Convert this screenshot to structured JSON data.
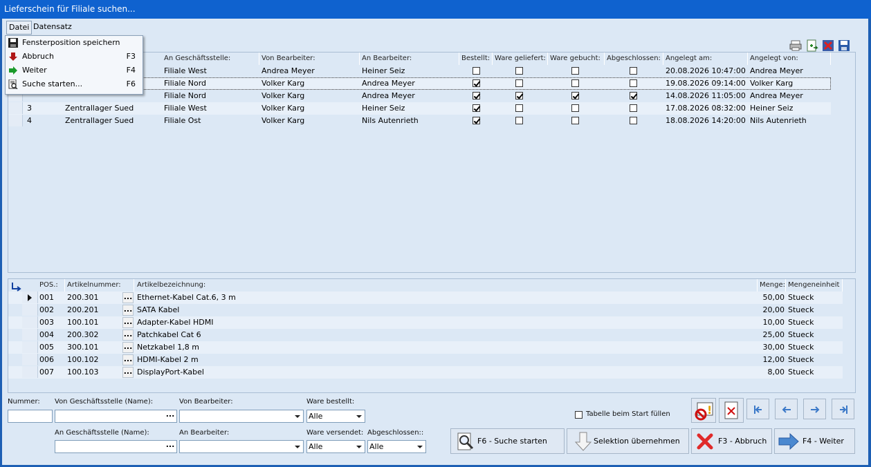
{
  "window": {
    "title": "Lieferschein für Filiale suchen..."
  },
  "menu": {
    "items": [
      {
        "label": "Datei"
      },
      {
        "label": "Datensatz"
      }
    ],
    "dropdown": [
      {
        "label": "Fensterposition speichern",
        "key": "",
        "icon": "floppy-icon"
      },
      {
        "label": "Abbruch",
        "key": "F3",
        "icon": "arrow-down-red-icon"
      },
      {
        "label": "Weiter",
        "key": "F4",
        "icon": "arrow-right-green-icon"
      },
      {
        "label": "Suche starten...",
        "key": "F6",
        "icon": "search-document-icon"
      }
    ]
  },
  "top_grid": {
    "columns": [
      "",
      "",
      "An Geschäftsstelle:",
      "Von Bearbeiter:",
      "An Bearbeiter:",
      "Bestellt:",
      "Ware geliefert:",
      "Ware gebucht:",
      "Abgeschlossen:",
      "Angelegt am:",
      "Angelegt von:"
    ],
    "rows": [
      {
        "nr": "",
        "von": "",
        "an": "Filiale West",
        "von_bearb": "Andrea Meyer",
        "an_bearb": "Heiner Seiz",
        "bestellt": false,
        "geliefert": false,
        "gebucht": false,
        "abgeschlossen": false,
        "am": "20.08.2026 10:47:00",
        "von_user": "Andrea Meyer"
      },
      {
        "nr": "",
        "von": "",
        "an": "Filiale Nord",
        "von_bearb": "Volker Karg",
        "an_bearb": "Andrea Meyer",
        "bestellt": true,
        "geliefert": false,
        "gebucht": false,
        "abgeschlossen": false,
        "am": "19.08.2026 09:14:00",
        "von_user": "Volker Karg"
      },
      {
        "nr": "",
        "von": "",
        "an": "Filiale Nord",
        "von_bearb": "Volker Karg",
        "an_bearb": "Andrea Meyer",
        "bestellt": true,
        "geliefert": true,
        "gebucht": true,
        "abgeschlossen": true,
        "am": "14.08.2026 11:05:00",
        "von_user": "Andrea Meyer"
      },
      {
        "nr": "3",
        "von": "Zentrallager Sued",
        "an": "Filiale West",
        "von_bearb": "Volker Karg",
        "an_bearb": "Heiner Seiz",
        "bestellt": true,
        "geliefert": false,
        "gebucht": false,
        "abgeschlossen": false,
        "am": "17.08.2026 08:32:00",
        "von_user": "Heiner Seiz"
      },
      {
        "nr": "4",
        "von": "Zentrallager Sued",
        "an": "Filiale Ost",
        "von_bearb": "Volker Karg",
        "an_bearb": "Nils Autenrieth",
        "bestellt": true,
        "geliefert": false,
        "gebucht": false,
        "abgeschlossen": false,
        "am": "18.08.2026 14:20:00",
        "von_user": "Nils Autenrieth"
      }
    ]
  },
  "bottom_grid": {
    "columns": [
      "POS.:",
      "Artikelnummer:",
      "Artikelbezeichnung:",
      "Menge:",
      "Mengeneinheit"
    ],
    "rows": [
      {
        "pos": "001",
        "artnr": "200.301",
        "dots": "...",
        "bez": "Ethernet-Kabel Cat.6, 3 m",
        "menge": "50,00",
        "einheit": "Stueck"
      },
      {
        "pos": "002",
        "artnr": "200.201",
        "dots": "...",
        "bez": "SATA Kabel",
        "menge": "20,00",
        "einheit": "Stueck"
      },
      {
        "pos": "003",
        "artnr": "100.101",
        "dots": "...",
        "bez": "Adapter-Kabel HDMI",
        "menge": "10,00",
        "einheit": "Stueck"
      },
      {
        "pos": "004",
        "artnr": "200.302",
        "dots": "...",
        "bez": "Patchkabel Cat 6",
        "menge": "25,00",
        "einheit": "Stueck"
      },
      {
        "pos": "005",
        "artnr": "300.101",
        "dots": "...",
        "bez": "Netzkabel 1,8 m",
        "menge": "30,00",
        "einheit": "Stueck"
      },
      {
        "pos": "006",
        "artnr": "100.102",
        "dots": "...",
        "bez": "HDMI-Kabel 2 m",
        "menge": "12,00",
        "einheit": "Stueck"
      },
      {
        "pos": "007",
        "artnr": "100.103",
        "dots": "...",
        "bez": "DisplayPort-Kabel",
        "menge": "8,00",
        "einheit": "Stueck"
      }
    ]
  },
  "filters": {
    "nummer_label": "Nummer:",
    "von_gs_label": "Von Geschäftsstelle (Name):",
    "von_bearb_label": "Von Bearbeiter:",
    "ware_bestellt_label": "Ware bestellt:",
    "ware_bestellt_value": "Alle",
    "an_gs_label": "An Geschäftsstelle (Name):",
    "an_bearb_label": "An Bearbeiter:",
    "ware_versendet_label": "Ware versendet:",
    "ware_versendet_value": "Alle",
    "abgeschlossen_label": "Abgeschlossen::",
    "abgeschlossen_value": "Alle",
    "dots": "...",
    "tabelle_start_label": "Tabelle beim Start füllen"
  },
  "buttons": {
    "suche": "F6 - Suche starten",
    "selektion": "Selektion übernehmen",
    "abbruch": "F3 - Abbruch",
    "weiter": "F4 - Weiter"
  }
}
